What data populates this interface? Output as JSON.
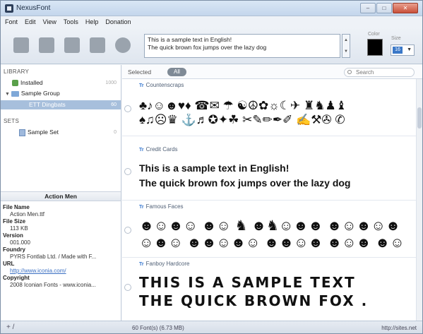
{
  "window": {
    "title": "NexusFont",
    "minimize": "–",
    "maximize": "□",
    "close": "✕"
  },
  "menu": [
    "Font",
    "Edit",
    "View",
    "Tools",
    "Help",
    "Donation"
  ],
  "toolbar": {
    "sample_line1": "This is a sample text in English!",
    "sample_line2": "The quick brown fox jumps over the lazy dog",
    "color_label": "Color",
    "size_label": "Size",
    "size_value": "16",
    "color_value": "#000000"
  },
  "library": {
    "header": "LIBRARY",
    "installed": {
      "label": "Installed",
      "count": "1000"
    },
    "group": {
      "label": "Sample Group"
    },
    "selected_item": {
      "label": "ETT Dingbats",
      "count": "60"
    }
  },
  "sets": {
    "header": "SETS",
    "item": {
      "label": "Sample Set",
      "count": "0"
    }
  },
  "info": {
    "title": "Action Men",
    "file_name_label": "File Name",
    "file_name": "Action Men.ttf",
    "file_size_label": "File Size",
    "file_size": "113 KB",
    "version_label": "Version",
    "version": "001.000",
    "foundry_label": "Foundry",
    "foundry": "PYRS Fontlab Ltd. / Made with F...",
    "url_label": "URL",
    "url": "http://www.iconia.com/",
    "copyright_label": "Copyright",
    "copyright": "2008 Iconian Fonts - www.iconia..."
  },
  "filter": {
    "selected_label": "Selected",
    "all_label": "All",
    "search_placeholder": "Search"
  },
  "fonts": [
    {
      "name": "Countenscraps",
      "line1": "♣♪☺☻♥♦ ☎✉ ☂ ☯☮✿☼☾✈ ♜♞♟♝",
      "line2": "♠♫☹♛ ⚓♬✪✦☘ ✂✎✏✒✐ ✍⚒✇ ✆"
    },
    {
      "name": "Credit Cards",
      "line1": "This is a sample text in English!",
      "line2": "The quick brown fox jumps over the lazy dog"
    },
    {
      "name": "Famous Faces",
      "line1": "☻☺☻☺ ☻☺ ♞ ☻♞☺☻☻ ☻☺☻☺☻",
      "line2": "☺☻☺ ☻☻☺☻☺ ☻☻☺☻ ☻☺☻ ☻☺"
    },
    {
      "name": "Fanboy Hardcore",
      "line1": "THIS IS A SAMPLE TEXT",
      "line2": "THE QUICK BROWN FOX ."
    }
  ],
  "status": {
    "left_icons": "+ /",
    "font_count": "60 Font(s) (6.73 MB)",
    "url": "http://sites.net"
  }
}
